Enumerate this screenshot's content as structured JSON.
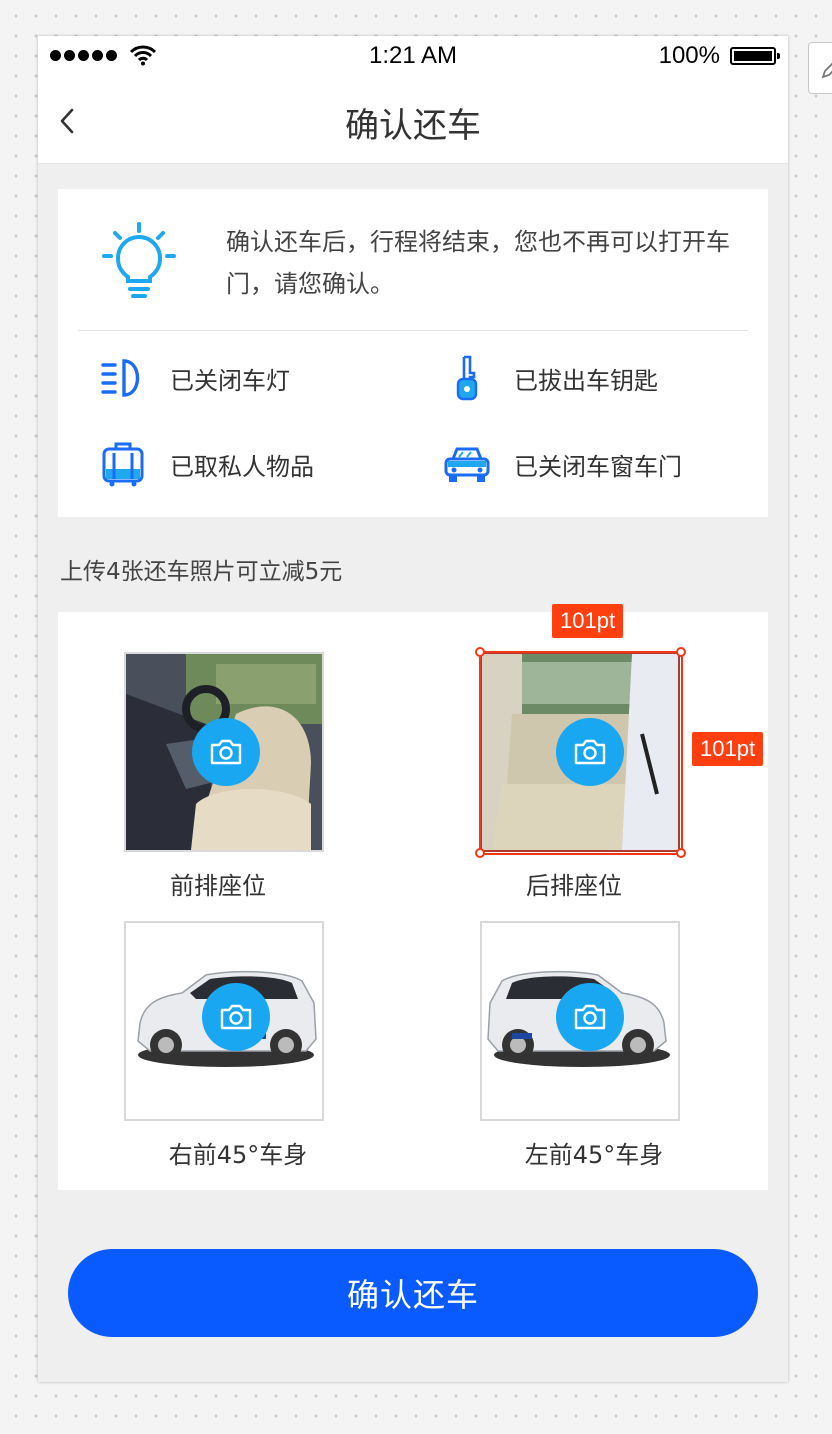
{
  "status_bar": {
    "time": "1:21 AM",
    "battery": "100%",
    "signal_icon": "signal-dots-icon",
    "wifi_icon": "wifi-icon",
    "battery_icon": "battery-icon"
  },
  "nav": {
    "title": "确认还车",
    "back_icon": "chevron-left-icon"
  },
  "tip": {
    "icon": "lightbulb-icon",
    "text": "确认还车后，行程将结束，您也不再可以打开车门，请您确认。"
  },
  "checklist": [
    {
      "icon": "headlight-icon",
      "label": "已关闭车灯"
    },
    {
      "icon": "car-key-icon",
      "label": "已拔出车钥匙"
    },
    {
      "icon": "luggage-icon",
      "label": "已取私人物品"
    },
    {
      "icon": "car-front-icon",
      "label": "已关闭车窗车门"
    }
  ],
  "upload_hint": "上传4张还车照片可立减5元",
  "photos": [
    {
      "label": "前排座位",
      "scene": "front-seat-photo"
    },
    {
      "label": "后排座位",
      "scene": "rear-seat-photo"
    },
    {
      "label": "右前45°车身",
      "scene": "car-right-front-photo"
    },
    {
      "label": "左前45°车身",
      "scene": "car-left-front-photo"
    }
  ],
  "design_overlay": {
    "width_label": "101pt",
    "height_label": "101pt"
  },
  "confirm_button": "确认还车",
  "colors": {
    "accent_blue": "#0a5bff",
    "camera_blue": "#19a7f2",
    "icon_blue": "#1a6cf6",
    "bulb_blue": "#1fa8ee",
    "measure_red": "#ff3f0f"
  }
}
